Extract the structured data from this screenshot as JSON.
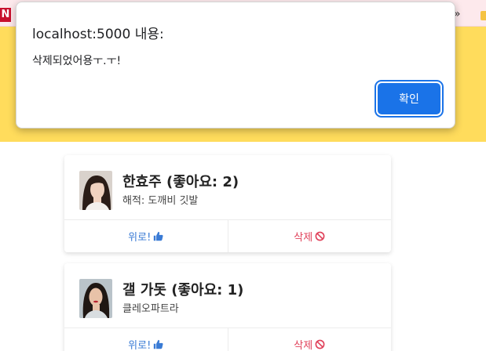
{
  "browser": {
    "bookmark_initial": "N",
    "overflow_chevron": "»"
  },
  "dialog": {
    "title": "localhost:5000 내용:",
    "message": "삭제되었어용ㅜ.ㅜ!",
    "ok_label": "확인"
  },
  "cards": [
    {
      "name": "한효주",
      "likes_text": "(좋아요: 2)",
      "description": "해적: 도깨비 깃발",
      "like_label": "위로!",
      "delete_label": "삭제"
    },
    {
      "name": "갤 가돗",
      "likes_text": "(좋아요: 1)",
      "description": "클레오파트라",
      "like_label": "위로!",
      "delete_label": "삭제"
    }
  ],
  "colors": {
    "banner": "#ffdc5c",
    "primary_button": "#1a73e8",
    "like": "#3a7bd5",
    "delete": "#e0415a"
  }
}
